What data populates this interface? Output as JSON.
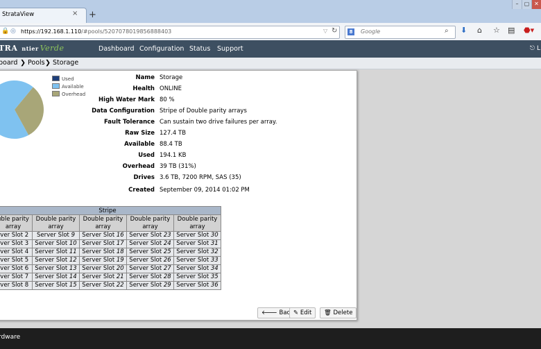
{
  "browser": {
    "tab_title": "StrataView",
    "tab_close": "×",
    "new_tab": "+",
    "window_buttons": [
      "–",
      "▢",
      "✕"
    ],
    "url_host": "https://192.168.1.110",
    "url_path": "/#pools/5207078019856888403",
    "search_placeholder": "Google",
    "search_engine_letter": "8"
  },
  "app": {
    "logo_main": "TRA",
    "logo_nt": "ntier",
    "logo_verde": "Verde",
    "menu": [
      "Dashboard",
      "Configuration",
      "Status",
      "Support"
    ],
    "user_menu": "L"
  },
  "breadcrumb": [
    "board",
    "Pools",
    "Storage"
  ],
  "pie": {
    "legend": [
      {
        "label": "Used",
        "color": "#1f3f7a"
      },
      {
        "label": "Available",
        "color": "#7fc2f0"
      },
      {
        "label": "Overhead",
        "color": "#a8a678"
      }
    ],
    "slices": [
      {
        "label": "Used",
        "percent": 0.0002
      },
      {
        "label": "Available",
        "percent": 69
      },
      {
        "label": "Overhead",
        "percent": 31
      }
    ]
  },
  "properties": [
    {
      "label": "Name",
      "value": "Storage"
    },
    {
      "label": "Health",
      "value": "ONLINE"
    },
    {
      "label": "High Water Mark",
      "value": "80 %"
    },
    {
      "label": "Data Configuration",
      "value": "Stripe of Double parity arrays"
    },
    {
      "label": "Fault Tolerance",
      "value": "Can sustain two drive failures per array."
    },
    {
      "label": "Raw Size",
      "value": "127.4 TB"
    },
    {
      "label": "Available",
      "value": "88.4 TB"
    },
    {
      "label": "Used",
      "value": "194.1 KB"
    },
    {
      "label": "Overhead",
      "value": "39 TB (31%)"
    },
    {
      "label": "Drives",
      "value": "3.6 TB, 7200 RPM, SAS (35)"
    },
    {
      "label": "Created",
      "value": "September 09, 2014 01:02 PM"
    }
  ],
  "stripe": {
    "title": "Stripe",
    "columns": [
      [
        "uble parity",
        "array"
      ],
      [
        "Double parity",
        "array"
      ],
      [
        "Double parity",
        "array"
      ],
      [
        "Double parity",
        "array"
      ],
      [
        "Double parity",
        "array"
      ]
    ],
    "slot_prefix": [
      "rver Slot",
      "Server Slot",
      "Server Slot",
      "Server Slot",
      "Server Slot"
    ],
    "slots": [
      [
        "2",
        "9",
        "16",
        "23",
        "30"
      ],
      [
        "3",
        "10",
        "17",
        "24",
        "31"
      ],
      [
        "4",
        "11",
        "18",
        "25",
        "32"
      ],
      [
        "5",
        "12",
        "19",
        "26",
        "33"
      ],
      [
        "6",
        "13",
        "20",
        "27",
        "34"
      ],
      [
        "7",
        "14",
        "21",
        "28",
        "35"
      ],
      [
        "8",
        "15",
        "22",
        "29",
        "36"
      ]
    ]
  },
  "buttons": {
    "back": "Back",
    "edit": "Edit",
    "delete": "Delete"
  },
  "footer": {
    "text": "rdware"
  }
}
